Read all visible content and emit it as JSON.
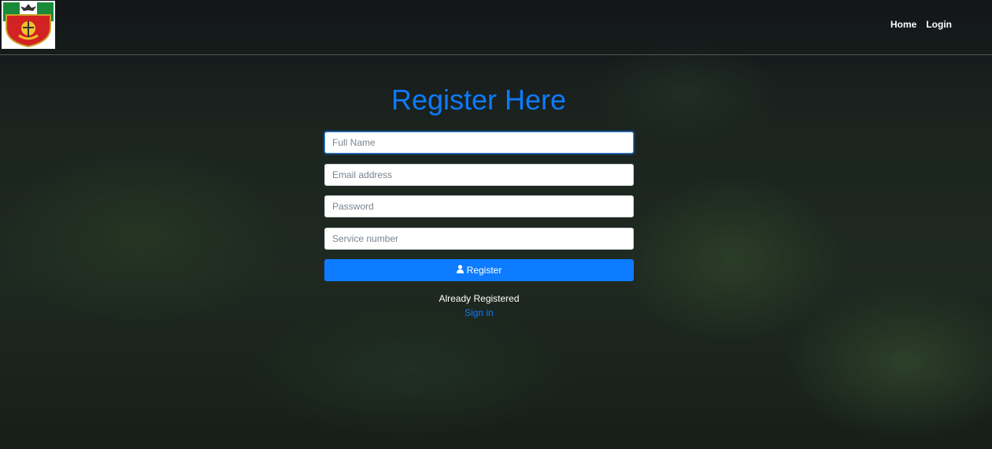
{
  "nav": {
    "links": [
      "Home",
      "Login"
    ]
  },
  "form": {
    "title": "Register Here",
    "fields": [
      {
        "placeholder": "Full Name",
        "value": ""
      },
      {
        "placeholder": "Email address",
        "value": ""
      },
      {
        "placeholder": "Password",
        "value": ""
      },
      {
        "placeholder": "Service number",
        "value": ""
      }
    ],
    "register_label": "Register",
    "register_icon": "user-icon"
  },
  "footer": {
    "already_text": "Already Registered",
    "signin_link": "Sign in"
  },
  "colors": {
    "accent": "#0d7bff",
    "text_light": "#ffffff"
  }
}
